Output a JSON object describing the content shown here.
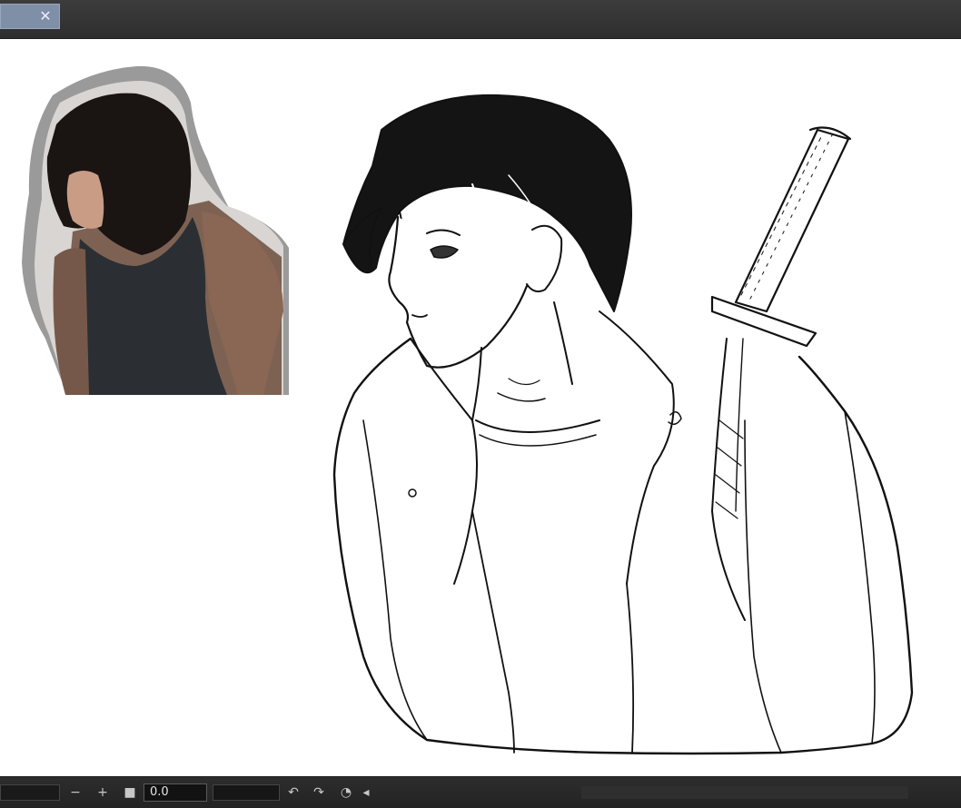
{
  "window": {
    "tab_close_icon": "close-icon"
  },
  "statusbar": {
    "zoom_out_label": "−",
    "zoom_in_label": "+",
    "angle_value": "0.0",
    "icons": {
      "fit": "square-icon",
      "rotate_left": "rotate-left-icon",
      "rotate_right": "rotate-right-icon",
      "reset_rotation": "reset-rotation-icon",
      "flip": "flip-icon"
    }
  },
  "canvas": {
    "reference_photo": "reference-photo",
    "sketch": "character-sketch"
  }
}
